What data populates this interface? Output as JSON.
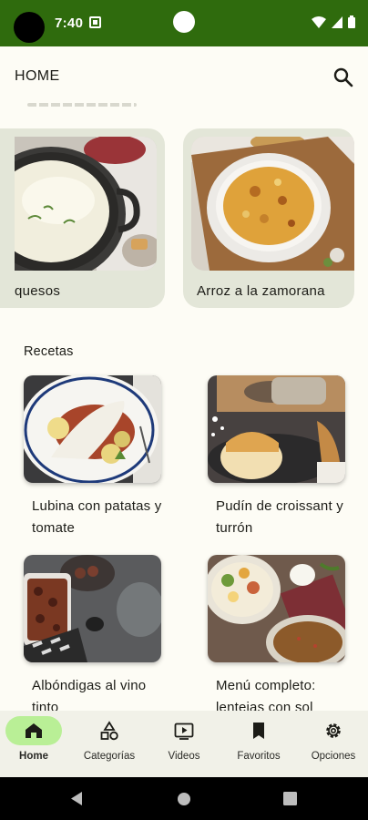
{
  "status_bar": {
    "time": "7:40"
  },
  "app_bar": {
    "title": "HOME",
    "search_icon": "search-icon"
  },
  "featured": [
    {
      "label": "quesos"
    },
    {
      "label": "Arroz a la zamorana"
    }
  ],
  "recipes_section": {
    "title": "Recetas",
    "items": [
      {
        "label": "Lubina con patatas y tomate"
      },
      {
        "label": "Pudín de croissant y turrón"
      },
      {
        "label": "Albóndigas al vino tinto"
      },
      {
        "label": "Menú completo: lentejas con sol"
      }
    ]
  },
  "bottom_nav": {
    "active": "Home",
    "items": [
      {
        "label": "Home",
        "icon": "home-icon"
      },
      {
        "label": "Categorías",
        "icon": "categories-icon"
      },
      {
        "label": "Videos",
        "icon": "video-icon"
      },
      {
        "label": "Favoritos",
        "icon": "bookmark-icon"
      },
      {
        "label": "Opciones",
        "icon": "gear-icon"
      }
    ]
  },
  "colors": {
    "status_bar": "#2f6b0d",
    "background": "#fdfcf5",
    "active_pill": "#b9ef96",
    "card_bg": "#e3e6d8"
  }
}
